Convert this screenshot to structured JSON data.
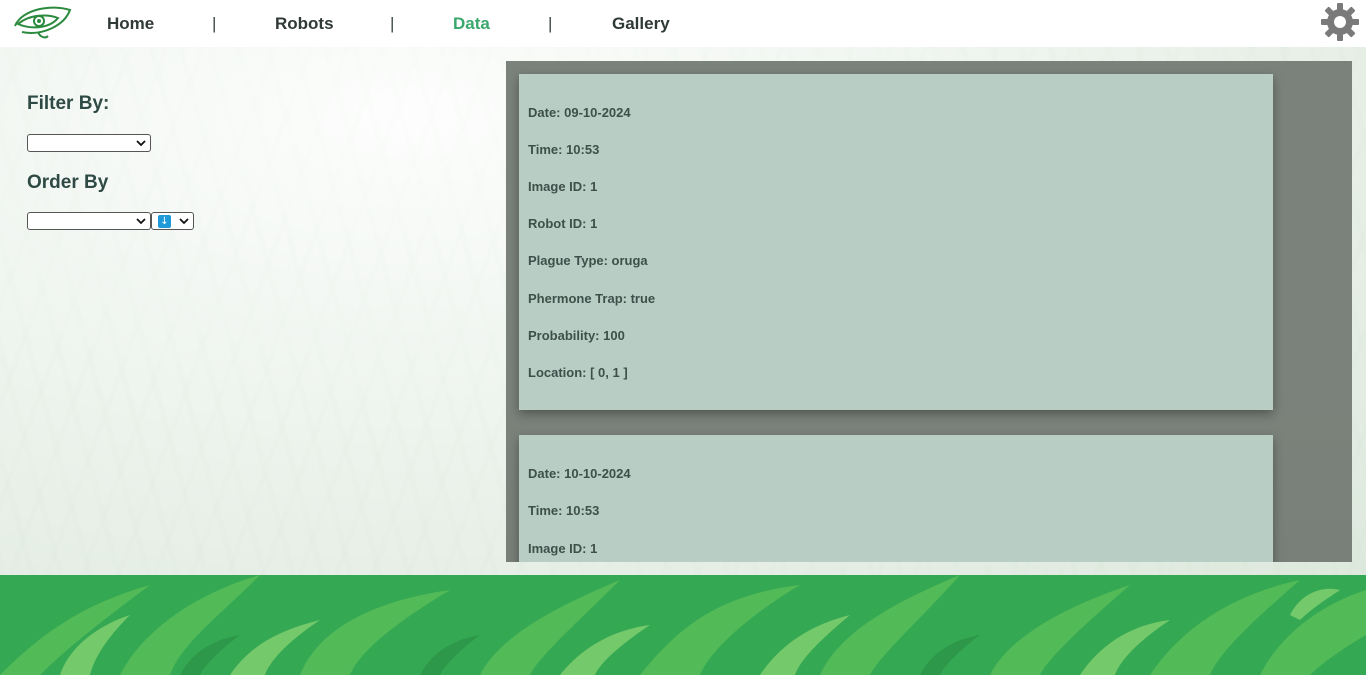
{
  "nav": {
    "links": [
      {
        "label": "Home",
        "active": false
      },
      {
        "label": "Robots",
        "active": false
      },
      {
        "label": "Data",
        "active": true
      },
      {
        "label": "Gallery",
        "active": false
      }
    ],
    "separator": "|",
    "accent_color": "#3aa76d"
  },
  "icons": {
    "logo": "leaf-eye-logo",
    "settings": "gear-icon",
    "sort": "sort-descending-icon"
  },
  "sidebar": {
    "filter_heading": "Filter By:",
    "filter_value": "",
    "order_heading": "Order By",
    "order_value": ""
  },
  "records": [
    {
      "date": "Date: 09-10-2024",
      "time": "Time: 10:53",
      "image_id": "Image ID: 1",
      "robot_id": "Robot ID: 1",
      "plague_type": "Plague Type: oruga",
      "phermone_trap": "Phermone Trap: true",
      "probability": "Probability: 100",
      "location": "Location: [ 0, 1 ]"
    },
    {
      "date": "Date: 10-10-2024",
      "time": "Time: 10:53",
      "image_id": "Image ID: 1"
    }
  ],
  "colors": {
    "card_bg": "#b8cec5",
    "panel_bg": "#7b827b",
    "footer_green": "#35a853"
  }
}
